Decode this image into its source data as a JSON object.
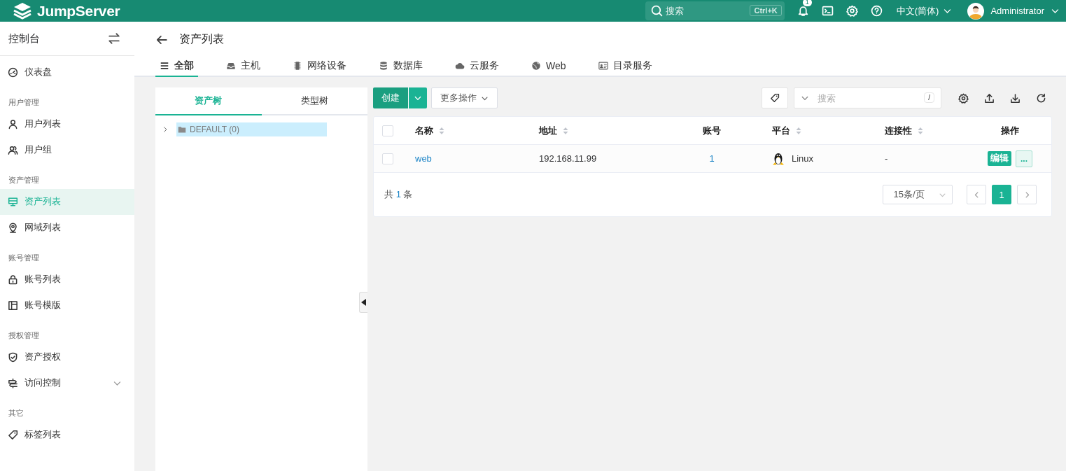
{
  "topbar": {
    "logo": "JumpServer",
    "search": {
      "placeholder": "搜索",
      "shortcut": "Ctrl+K"
    },
    "notifications": {
      "badge": "1"
    },
    "language": "中文(简体)",
    "user": "Administrator"
  },
  "sidebar": {
    "title": "控制台",
    "items": [
      {
        "kind": "item",
        "label": "仪表盘",
        "selected": false
      },
      {
        "kind": "section",
        "label": "用户管理"
      },
      {
        "kind": "item",
        "label": "用户列表",
        "selected": false
      },
      {
        "kind": "item",
        "label": "用户组",
        "selected": false
      },
      {
        "kind": "section",
        "label": "资产管理"
      },
      {
        "kind": "item",
        "label": "资产列表",
        "selected": true
      },
      {
        "kind": "item",
        "label": "网域列表",
        "selected": false
      },
      {
        "kind": "section",
        "label": "账号管理"
      },
      {
        "kind": "item",
        "label": "账号列表",
        "selected": false
      },
      {
        "kind": "item",
        "label": "账号模版",
        "selected": false
      },
      {
        "kind": "section",
        "label": "授权管理"
      },
      {
        "kind": "item",
        "label": "资产授权",
        "selected": false
      },
      {
        "kind": "item",
        "label": "访问控制",
        "selected": false,
        "expanded": false
      },
      {
        "kind": "section",
        "label": "其它"
      },
      {
        "kind": "item",
        "label": "标签列表",
        "selected": false
      }
    ]
  },
  "page": {
    "title": "资产列表",
    "tabs": [
      {
        "label": "全部",
        "selected": true
      },
      {
        "label": "主机",
        "selected": false
      },
      {
        "label": "网络设备",
        "selected": false
      },
      {
        "label": "数据库",
        "selected": false
      },
      {
        "label": "云服务",
        "selected": false
      },
      {
        "label": "Web",
        "selected": false
      },
      {
        "label": "目录服务",
        "selected": false
      }
    ]
  },
  "tree": {
    "tabs": [
      {
        "label": "资产树",
        "selected": true
      },
      {
        "label": "类型树",
        "selected": false
      }
    ],
    "nodes": [
      {
        "label": "DEFAULT (0)",
        "selected": true,
        "expanded": false
      }
    ]
  },
  "toolbar": {
    "create": "创建",
    "more": "更多操作",
    "search": {
      "placeholder": "搜索",
      "shortcut": "/"
    }
  },
  "table": {
    "header_checked": false,
    "columns": [
      {
        "label": "名称",
        "sortable": true
      },
      {
        "label": "地址",
        "sortable": true
      },
      {
        "label": "账号",
        "sortable": false
      },
      {
        "label": "平台",
        "sortable": true
      },
      {
        "label": "连接性",
        "sortable": true
      },
      {
        "label": "操作",
        "sortable": false
      }
    ],
    "rows": [
      {
        "checked": false,
        "name": "web",
        "address": "192.168.11.99",
        "accounts": "1",
        "platform": "Linux",
        "connectivity": "-",
        "edit": "编辑",
        "more": "..."
      }
    ]
  },
  "pagination": {
    "total_prefix": "共",
    "total": "1",
    "total_suffix": "条",
    "page_size": "15条/页",
    "pages": [
      {
        "label": "1",
        "selected": true
      }
    ]
  }
}
